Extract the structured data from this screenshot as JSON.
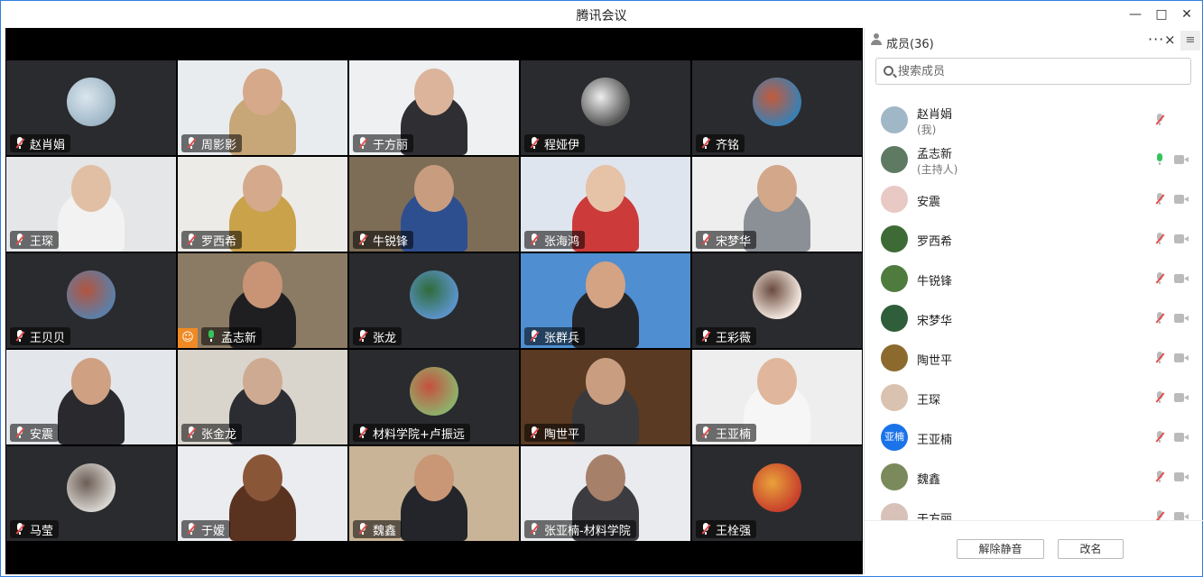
{
  "window": {
    "title": "腾讯会议"
  },
  "colors": {
    "accent": "#2f7fe0",
    "active_speaker": "#2dbb5d",
    "muted": "#e34d4d",
    "host_badge": "#f08a24"
  },
  "tiles": [
    {
      "name": "赵肖娟",
      "kind": "avatar",
      "c1": "#9fb7c7",
      "c2": "#dbe6ee"
    },
    {
      "name": "周影影",
      "kind": "cam",
      "wall": "#e9ecef",
      "shirt": "#c7a678",
      "face": "#d6a98a"
    },
    {
      "name": "于方丽",
      "kind": "cam",
      "wall": "#eef0f2",
      "shirt": "#2e2e33",
      "face": "#dcb49b"
    },
    {
      "name": "程娅伊",
      "kind": "avatar",
      "c1": "#555",
      "c2": "#eee"
    },
    {
      "name": "齐铭",
      "kind": "avatar",
      "c1": "#3b7fb3",
      "c2": "#c55a3a"
    },
    {
      "name": "王琛",
      "kind": "cam",
      "wall": "#e4e6e8",
      "shirt": "#f2f2f2",
      "face": "#e1bfa4"
    },
    {
      "name": "罗西希",
      "kind": "cam",
      "wall": "#ecebe8",
      "shirt": "#c9a24a",
      "face": "#d4a98c"
    },
    {
      "name": "牛锐锋",
      "kind": "cam",
      "wall": "#7d6d57",
      "shirt": "#2e4f8f",
      "face": "#c89c7f"
    },
    {
      "name": "张海鸿",
      "kind": "cam",
      "wall": "#dfe5ee",
      "shirt": "#cc3a3a",
      "face": "#e6c2a6"
    },
    {
      "name": "宋梦华",
      "kind": "cam",
      "wall": "#eeeeee",
      "shirt": "#8b8f96",
      "face": "#d2a78a"
    },
    {
      "name": "王贝贝",
      "kind": "avatar",
      "c1": "#5c7fa8",
      "c2": "#b3543e"
    },
    {
      "name": "孟志新",
      "kind": "cam",
      "wall": "#8c7b64",
      "shirt": "#1f1f22",
      "face": "#c99475",
      "active": true,
      "host": true
    },
    {
      "name": "张龙",
      "kind": "avatar",
      "c1": "#5b93c8",
      "c2": "#2f6b3b"
    },
    {
      "name": "张群兵",
      "kind": "cam",
      "wall": "#4f8ed1",
      "shirt": "#25262a",
      "face": "#d3a383"
    },
    {
      "name": "王彩薇",
      "kind": "avatar",
      "c1": "#f1e5dc",
      "c2": "#6a4a3f"
    },
    {
      "name": "安震",
      "kind": "cam",
      "wall": "#e3e6ea",
      "shirt": "#2a2a2e",
      "face": "#cfa081"
    },
    {
      "name": "张金龙",
      "kind": "cam",
      "wall": "#d9d5cd",
      "shirt": "#2b2d33",
      "face": "#ceaa92"
    },
    {
      "name": "材料学院+卢振远",
      "kind": "avatar",
      "c1": "#8fb06a",
      "c2": "#c6503f"
    },
    {
      "name": "陶世平",
      "kind": "cam",
      "wall": "#5a3a22",
      "shirt": "#3a3a3d",
      "face": "#c99d80"
    },
    {
      "name": "王亚楠",
      "kind": "cam",
      "wall": "#eeeeee",
      "shirt": "#f6f6f6",
      "face": "#e0b79c"
    },
    {
      "name": "马莹",
      "kind": "avatar",
      "c1": "#d7d3cf",
      "c2": "#6c5e55"
    },
    {
      "name": "于嫒",
      "kind": "cam",
      "wall": "#eaecef",
      "shirt": "#5a3220",
      "face": "#8a5638"
    },
    {
      "name": "魏鑫",
      "kind": "cam",
      "wall": "#c9b497",
      "shirt": "#23252a",
      "face": "#c99676"
    },
    {
      "name": "张亚楠-材料学院",
      "kind": "cam",
      "wall": "#e9ebee",
      "shirt": "#3c3c40",
      "face": "#a7806a"
    },
    {
      "name": "王栓强",
      "kind": "avatar",
      "c1": "#c8412c",
      "c2": "#e9a23b"
    }
  ],
  "panel": {
    "title": "成员(36)",
    "more": "···",
    "close": "×",
    "menu": "≡",
    "search_placeholder": "搜索成员",
    "members": [
      {
        "name": "赵肖娟",
        "role": "(我)",
        "avatar": "#9fb7c7",
        "mic": "muted",
        "cam": false
      },
      {
        "name": "孟志新",
        "role": "(主持人)",
        "avatar": "#5e7a63",
        "mic": "on",
        "cam": true
      },
      {
        "name": "安震",
        "role": "",
        "avatar": "#e8c9c4",
        "mic": "muted",
        "cam": true
      },
      {
        "name": "罗西希",
        "role": "",
        "avatar": "#3e6b35",
        "mic": "muted",
        "cam": true
      },
      {
        "name": "牛锐锋",
        "role": "",
        "avatar": "#4f7b3f",
        "mic": "muted",
        "cam": true
      },
      {
        "name": "宋梦华",
        "role": "",
        "avatar": "#2f5e3a",
        "mic": "muted",
        "cam": true
      },
      {
        "name": "陶世平",
        "role": "",
        "avatar": "#8c6a2e",
        "mic": "muted",
        "cam": true
      },
      {
        "name": "王琛",
        "role": "",
        "avatar": "#d9c3b0",
        "mic": "muted",
        "cam": true
      },
      {
        "name": "王亚楠",
        "role": "",
        "avatar": "#1a73e8",
        "text": "亚楠",
        "mic": "muted",
        "cam": true
      },
      {
        "name": "魏鑫",
        "role": "",
        "avatar": "#7a8a5a",
        "mic": "muted",
        "cam": true
      },
      {
        "name": "于方丽",
        "role": "",
        "avatar": "#d7c1b8",
        "mic": "muted",
        "cam": true
      }
    ],
    "unmute_label": "解除静音",
    "rename_label": "改名"
  }
}
